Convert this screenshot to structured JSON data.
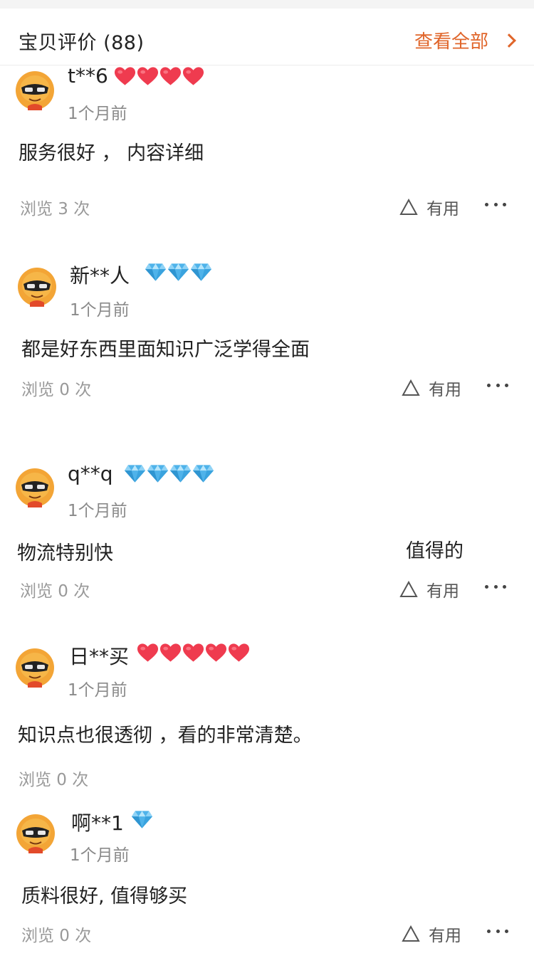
{
  "header": {
    "title": "宝贝评价 (88)",
    "view_all": "查看全部"
  },
  "colors": {
    "accent": "#e0652a",
    "heart": "#ef3b4f",
    "diamond": "#4fb3ea"
  },
  "reviews": [
    {
      "user": "t**6",
      "badge_type": "heart",
      "badge_count": 4,
      "time": "1个月前",
      "text": "服务很好 ， 内容详细",
      "text_extra": "",
      "views": "浏览 3 次",
      "useful": "有用"
    },
    {
      "user": "新**人",
      "badge_type": "diamond",
      "badge_count": 3,
      "time": "1个月前",
      "text": "都是好东西里面知识广泛学得全面",
      "text_extra": "",
      "views": "浏览 0 次",
      "useful": "有用"
    },
    {
      "user": "q**q",
      "badge_type": "diamond",
      "badge_count": 4,
      "time": "1个月前",
      "text": "物流特别快",
      "text_extra": "值得的",
      "views": "浏览 0 次",
      "useful": "有用"
    },
    {
      "user": "日**买",
      "badge_type": "heart",
      "badge_count": 5,
      "time": "1个月前",
      "text": "知识点也很透彻 ，看的非常清楚。",
      "text_extra": "",
      "views": "浏览 0 次",
      "useful": ""
    },
    {
      "user": "啊**1",
      "badge_type": "diamond",
      "badge_count": 1,
      "time": "1个月前",
      "text": "质料很好, 值得够买",
      "text_extra": "",
      "views": "浏览 0 次",
      "useful": "有用"
    }
  ]
}
